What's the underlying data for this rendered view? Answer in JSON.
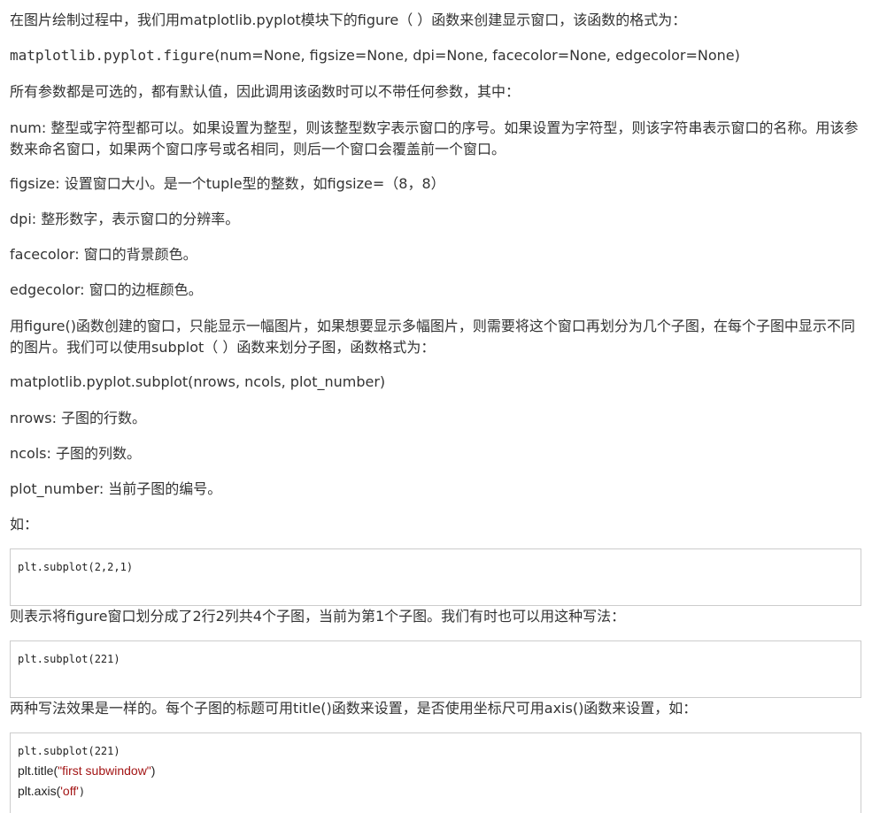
{
  "paragraphs": {
    "p1": "在图片绘制过程中，我们用matplotlib.pyplot模块下的figure（ ）函数来创建显示窗口，该函数的格式为：",
    "figure_sig_prefix": "matplotlib.pyplot.figure",
    "figure_sig_args": "(num=None, figsize=None, dpi=None, facecolor=None, edgecolor=None)",
    "p3": "所有参数都是可选的，都有默认值，因此调用该函数时可以不带任何参数，其中：",
    "num_line1": "num: 整型或字符型都可以。如果设置为整型，则该整型数字表示窗口的序号。如果设置为字符型，则该字符串表示窗口的名称。用该参",
    "num_line2": "数来命名窗口，如果两个窗口序号或名相同，则后一个窗口会覆盖前一个窗口。",
    "figsize": "figsize: 设置窗口大小。是一个tuple型的整数，如figsize=（8，8）",
    "dpi": "dpi: 整形数字，表示窗口的分辨率。",
    "facecolor": "facecolor: 窗口的背景颜色。",
    "edgecolor": "edgecolor: 窗口的边框颜色。",
    "subplot_line1": "用figure()函数创建的窗口，只能显示一幅图片，如果想要显示多幅图片，则需要将这个窗口再划分为几个子图，在每个子图中显示不同",
    "subplot_line2": "的图片。我们可以使用subplot（ ）函数来划分子图，函数格式为：",
    "subplot_sig": "matplotlib.pyplot.subplot(nrows, ncols, plot_number)",
    "nrows": "nrows: 子图的行数。",
    "ncols": "ncols: 子图的列数。",
    "plot_number": "plot_number: 当前子图的编号。",
    "example_intro": "如：",
    "after_code1": "则表示将figure窗口划分成了2行2列共4个子图，当前为第1个子图。我们有时也可以用这种写法：",
    "after_code2": "两种写法效果是一样的。每个子图的标题可用title()函数来设置，是否使用坐标尺可用axis()函数来设置，如："
  },
  "code_blocks": {
    "code1": "plt.subplot(2,2,1)",
    "code2": "plt.subplot(221)",
    "code3_line1": "plt.subplot(221)",
    "code3_line2_prefix": "plt.title(",
    "code3_line2_str": "\"first subwindow\"",
    "code3_line2_suffix": ")",
    "code3_line3_prefix": "plt.axis(",
    "code3_line3_str": "'off'",
    "code3_line3_suffix": ")"
  },
  "colors": {
    "text": "#333333",
    "code_border": "#cccccc",
    "string": "#a31515"
  }
}
